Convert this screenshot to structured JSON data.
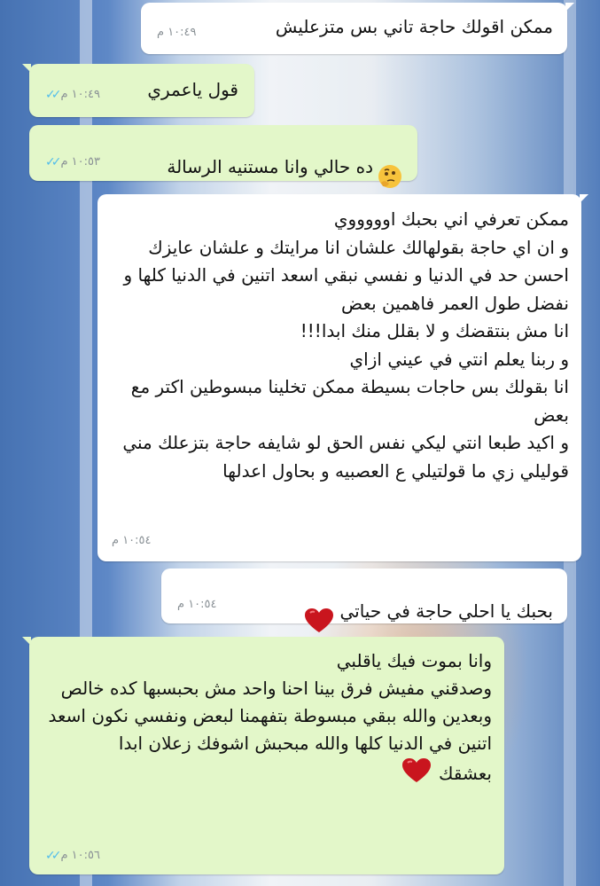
{
  "messages": [
    {
      "text": "ممكن اقولك حاجة تاني بس متزعليش",
      "time": "١٠:٤٩ م",
      "icon": null
    },
    {
      "text": "قول ياعمري",
      "time": "١٠:٤٩ م",
      "icon": null
    },
    {
      "text": "ده حالي وانا مستنيه الرسالة",
      "time": "١٠:٥٣ م",
      "icon": "thinking-face"
    },
    {
      "text": "ممكن تعرفي اني بحبك اوووووي\nو ان اي حاجة بقولهالك علشان انا مرايتك و علشان عايزك احسن حد في الدنيا و نفسي نبقي اسعد اتنين في الدنيا كلها و نفضل طول العمر فاهمين بعض\nانا مش بنتقضك و لا بقلل منك ابدا!!!\nو ربنا يعلم انتي في عيني ازاي\nانا بقولك بس حاجات بسيطة ممكن تخلينا مبسوطين اكتر مع بعض\nو اكيد طبعا انتي ليكي نفس الحق لو شايفه حاجة بتزعلك مني قوليلي زي ما قولتيلي ع العصبيه و بحاول اعدلها",
      "time": "١٠:٥٤ م",
      "icon": null
    },
    {
      "text": "بحبك يا احلي حاجة في حياتي",
      "time": "١٠:٥٤ م",
      "icon": "red-heart"
    },
    {
      "text": "وانا بموت فيك ياقلبي\nوصدقني مفيش فرق بينا احنا واحد مش بحبسبها كده خالص\nوبعدين والله ببقي مبسوطة بتفهمنا لبعض ونفسي نكون اسعد اتنين في الدنيا كلها والله مبحبش اشوفك زعلان ابدا\nبعشقك",
      "time": "١٠:٥٦ م",
      "icon": "red-heart"
    }
  ],
  "colors": {
    "incoming_bubble": "#ffffff",
    "outgoing_bubble": "#e3f7c9",
    "read_ticks": "#53bdeb",
    "timestamp": "#8a9196"
  }
}
